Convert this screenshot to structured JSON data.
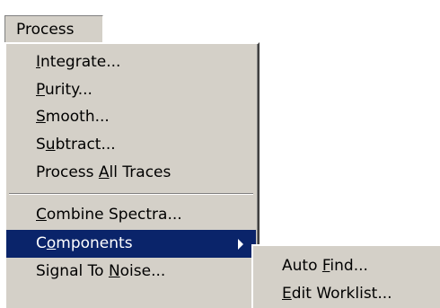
{
  "menu": {
    "title": "Process",
    "items": [
      {
        "pre": "",
        "key": "I",
        "post": "ntegrate..."
      },
      {
        "pre": "",
        "key": "P",
        "post": "urity..."
      },
      {
        "pre": "",
        "key": "S",
        "post": "mooth..."
      },
      {
        "pre": "S",
        "key": "u",
        "post": "btract..."
      },
      {
        "pre": "Process ",
        "key": "A",
        "post": "ll Traces"
      },
      {
        "pre": "",
        "key": "C",
        "post": "ombine Spectra..."
      },
      {
        "pre": "C",
        "key": "o",
        "post": "mponents"
      },
      {
        "pre": "Signal To ",
        "key": "N",
        "post": "oise..."
      }
    ]
  },
  "submenu": {
    "items": [
      {
        "pre": "Auto ",
        "key": "F",
        "post": "ind..."
      },
      {
        "pre": "",
        "key": "E",
        "post": "dit Worklist..."
      }
    ]
  }
}
